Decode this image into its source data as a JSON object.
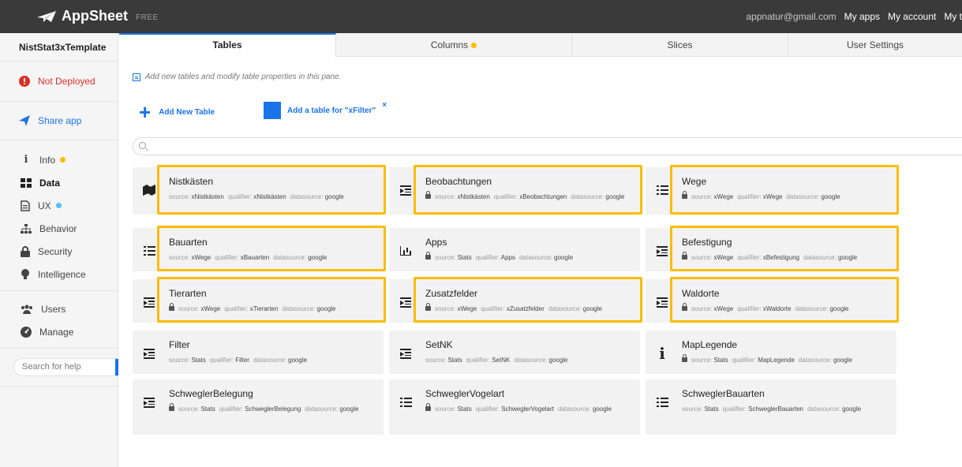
{
  "brand": {
    "name": "AppSheet",
    "tier": "FREE"
  },
  "topnav": {
    "email": "appnatur@gmail.com",
    "my_apps": "My apps",
    "my_account": "My account",
    "my_teams": "My t"
  },
  "sidebar": {
    "app_name": "NistStat3xTemplate",
    "deploy_status": "Not Deployed",
    "share": "Share app",
    "nav": [
      {
        "label": "Info",
        "dot": "#fbbc04"
      },
      {
        "label": "Data",
        "active": true
      },
      {
        "label": "UX",
        "dot": "#4fc3f7"
      },
      {
        "label": "Behavior"
      },
      {
        "label": "Security"
      },
      {
        "label": "Intelligence"
      }
    ],
    "nav2": [
      {
        "label": "Users"
      },
      {
        "label": "Manage"
      }
    ],
    "help_placeholder": "Search for help"
  },
  "tabs": [
    "Tables",
    "Columns",
    "Slices",
    "User Settings"
  ],
  "hint": "Add new tables and modify table properties in this pane.",
  "actions": {
    "add_new": "Add New Table",
    "add_filter": "Add a table for \"xFilter\"",
    "dismiss": "×"
  },
  "meta_labels": {
    "source": "source:",
    "qualifier": "qualifier:",
    "datasource": "datasource:"
  },
  "tables": [
    {
      "name": "Nistkästen",
      "icon": "map-icon",
      "locked": false,
      "source": "xNistkästen",
      "qualifier": "xNistkästen",
      "datasource": "google",
      "highlight": true
    },
    {
      "name": "Beobachtungen",
      "icon": "deck-icon",
      "locked": true,
      "source": "xNistkästen",
      "qualifier": "xBeobachtungen",
      "datasource": "google",
      "highlight": true
    },
    {
      "name": "Wege",
      "icon": "list-icon",
      "locked": true,
      "source": "xWege",
      "qualifier": "xWege",
      "datasource": "google",
      "highlight": true
    },
    {
      "name": "Bauarten",
      "icon": "list-icon",
      "locked": false,
      "source": "xWege",
      "qualifier": "xBauarten",
      "datasource": "google",
      "highlight": true
    },
    {
      "name": "Apps",
      "icon": "chart-icon",
      "locked": true,
      "source": "Stats",
      "qualifier": "Apps",
      "datasource": "google",
      "highlight": false
    },
    {
      "name": "Befestigung",
      "icon": "deck-icon",
      "locked": true,
      "source": "xWege",
      "qualifier": "xBefestigung",
      "datasource": "google",
      "highlight": true
    },
    {
      "name": "Tierarten",
      "icon": "deck-icon",
      "locked": true,
      "source": "xWege",
      "qualifier": "xTierarten",
      "datasource": "google",
      "highlight": true
    },
    {
      "name": "Zusatzfelder",
      "icon": "deck-icon",
      "locked": true,
      "source": "xWege",
      "qualifier": "xZusatzfelder",
      "datasource": "google",
      "highlight": true
    },
    {
      "name": "Waldorte",
      "icon": "deck-icon",
      "locked": true,
      "source": "xWege",
      "qualifier": "xWaldorte",
      "datasource": "google",
      "highlight": true
    },
    {
      "name": "Filter",
      "icon": "deck-icon",
      "locked": false,
      "source": "Stats",
      "qualifier": "Filter",
      "datasource": "google",
      "highlight": false
    },
    {
      "name": "SetNK",
      "icon": "deck-icon",
      "locked": false,
      "source": "Stats",
      "qualifier": "SetNK",
      "datasource": "google",
      "highlight": false
    },
    {
      "name": "MapLegende",
      "icon": "info-icon",
      "locked": true,
      "source": "Stats",
      "qualifier": "MapLegende",
      "datasource": "google",
      "highlight": false
    },
    {
      "name": "SchweglerBelegung",
      "icon": "deck-icon",
      "locked": true,
      "source": "Stats",
      "qualifier": "SchweglerBelegung",
      "datasource": "google",
      "highlight": false
    },
    {
      "name": "SchweglerVogelart",
      "icon": "list-icon",
      "locked": true,
      "source": "Stats",
      "qualifier": "SchweglerVogelart",
      "datasource": "google",
      "highlight": false
    },
    {
      "name": "SchweglerBauarten",
      "icon": "list-icon",
      "locked": false,
      "source": "Stats",
      "qualifier": "SchweglerBauarten",
      "datasource": "google",
      "highlight": false
    }
  ]
}
